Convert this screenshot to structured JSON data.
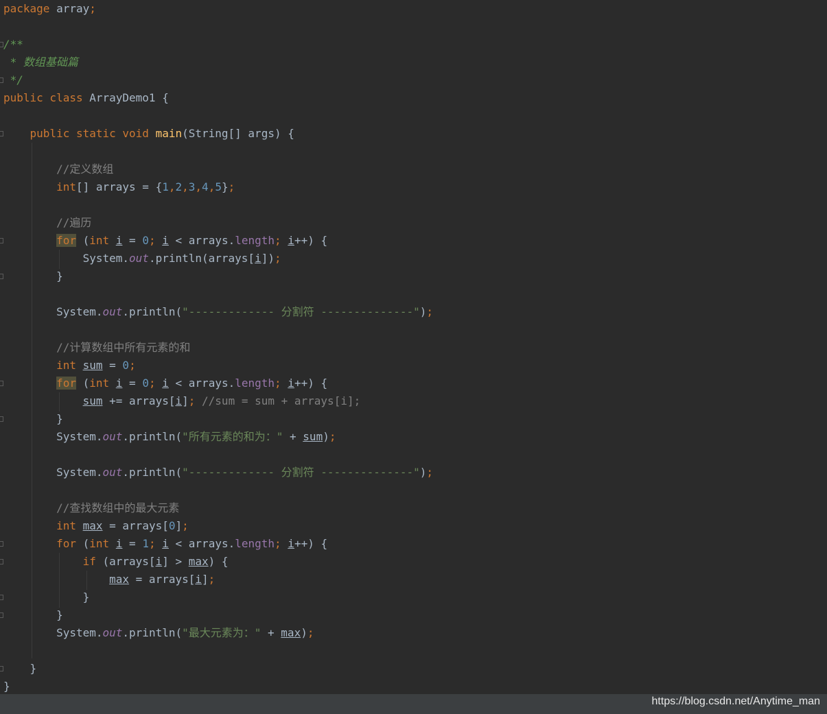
{
  "editor": {
    "colors": {
      "background": "#2b2b2b",
      "keyword": "#cc7832",
      "method": "#ffc66d",
      "number": "#6897bb",
      "string": "#6a8759",
      "comment": "#808080",
      "doc_comment": "#629755",
      "field": "#9876aa",
      "default_text": "#a9b7c6"
    },
    "lines": [
      {
        "tokens": [
          {
            "t": "package",
            "c": "kw"
          },
          {
            "t": " array"
          },
          {
            "t": ";",
            "c": "kw"
          }
        ]
      },
      {
        "tokens": []
      },
      {
        "tokens": [
          {
            "t": "/**",
            "c": "doc"
          }
        ]
      },
      {
        "tokens": [
          {
            "t": " * 数组基础篇",
            "c": "doc"
          }
        ]
      },
      {
        "tokens": [
          {
            "t": " */",
            "c": "doc"
          }
        ]
      },
      {
        "tokens": [
          {
            "t": "public class",
            "c": "kw"
          },
          {
            "t": " ArrayDemo1 {"
          }
        ]
      },
      {
        "tokens": []
      },
      {
        "tokens": [
          {
            "t": "    "
          },
          {
            "t": "public static void",
            "c": "kw"
          },
          {
            "t": " "
          },
          {
            "t": "main",
            "c": "fn"
          },
          {
            "t": "(String[] args) {"
          }
        ]
      },
      {
        "tokens": []
      },
      {
        "tokens": [
          {
            "t": "        "
          },
          {
            "t": "//定义数组",
            "c": "cmt"
          }
        ]
      },
      {
        "tokens": [
          {
            "t": "        "
          },
          {
            "t": "int",
            "c": "kw"
          },
          {
            "t": "[] arrays = {"
          },
          {
            "t": "1",
            "c": "num"
          },
          {
            "t": ",",
            "c": "kw"
          },
          {
            "t": "2",
            "c": "num"
          },
          {
            "t": ",",
            "c": "kw"
          },
          {
            "t": "3",
            "c": "num"
          },
          {
            "t": ",",
            "c": "kw"
          },
          {
            "t": "4",
            "c": "num"
          },
          {
            "t": ",",
            "c": "kw"
          },
          {
            "t": "5",
            "c": "num"
          },
          {
            "t": "}"
          },
          {
            "t": ";",
            "c": "kw"
          }
        ]
      },
      {
        "tokens": []
      },
      {
        "tokens": [
          {
            "t": "        "
          },
          {
            "t": "//遍历",
            "c": "cmt"
          }
        ]
      },
      {
        "tokens": [
          {
            "t": "        "
          },
          {
            "t": "for",
            "c": "kw hl"
          },
          {
            "t": " ("
          },
          {
            "t": "int",
            "c": "kw"
          },
          {
            "t": " "
          },
          {
            "t": "i",
            "c": "var"
          },
          {
            "t": " = "
          },
          {
            "t": "0",
            "c": "num"
          },
          {
            "t": ";",
            "c": "kw"
          },
          {
            "t": " "
          },
          {
            "t": "i",
            "c": "var"
          },
          {
            "t": " < arrays."
          },
          {
            "t": "length",
            "c": "fld"
          },
          {
            "t": ";",
            "c": "kw"
          },
          {
            "t": " "
          },
          {
            "t": "i",
            "c": "var"
          },
          {
            "t": "++) {"
          }
        ]
      },
      {
        "tokens": [
          {
            "t": "            System."
          },
          {
            "t": "out",
            "c": "static"
          },
          {
            "t": ".println(arrays["
          },
          {
            "t": "i",
            "c": "var"
          },
          {
            "t": "])"
          },
          {
            "t": ";",
            "c": "kw"
          }
        ]
      },
      {
        "tokens": [
          {
            "t": "        }"
          }
        ]
      },
      {
        "tokens": []
      },
      {
        "tokens": [
          {
            "t": "        System."
          },
          {
            "t": "out",
            "c": "static"
          },
          {
            "t": ".println("
          },
          {
            "t": "\"------------- 分割符 --------------\"",
            "c": "str"
          },
          {
            "t": ")"
          },
          {
            "t": ";",
            "c": "kw"
          }
        ]
      },
      {
        "tokens": []
      },
      {
        "tokens": [
          {
            "t": "        "
          },
          {
            "t": "//计算数组中所有元素的和",
            "c": "cmt"
          }
        ]
      },
      {
        "tokens": [
          {
            "t": "        "
          },
          {
            "t": "int",
            "c": "kw"
          },
          {
            "t": " "
          },
          {
            "t": "sum",
            "c": "var"
          },
          {
            "t": " = "
          },
          {
            "t": "0",
            "c": "num"
          },
          {
            "t": ";",
            "c": "kw"
          }
        ]
      },
      {
        "tokens": [
          {
            "t": "        "
          },
          {
            "t": "for",
            "c": "kw hl"
          },
          {
            "t": " ("
          },
          {
            "t": "int",
            "c": "kw"
          },
          {
            "t": " "
          },
          {
            "t": "i",
            "c": "var"
          },
          {
            "t": " = "
          },
          {
            "t": "0",
            "c": "num"
          },
          {
            "t": ";",
            "c": "kw"
          },
          {
            "t": " "
          },
          {
            "t": "i",
            "c": "var"
          },
          {
            "t": " < arrays."
          },
          {
            "t": "length",
            "c": "fld"
          },
          {
            "t": ";",
            "c": "kw"
          },
          {
            "t": " "
          },
          {
            "t": "i",
            "c": "var"
          },
          {
            "t": "++) {"
          }
        ]
      },
      {
        "tokens": [
          {
            "t": "            "
          },
          {
            "t": "sum",
            "c": "var"
          },
          {
            "t": " += arrays["
          },
          {
            "t": "i",
            "c": "var"
          },
          {
            "t": "]"
          },
          {
            "t": ";",
            "c": "kw"
          },
          {
            "t": " "
          },
          {
            "t": "//sum = sum + arrays[i];",
            "c": "cmt"
          }
        ]
      },
      {
        "tokens": [
          {
            "t": "        }"
          }
        ]
      },
      {
        "tokens": [
          {
            "t": "        System."
          },
          {
            "t": "out",
            "c": "static"
          },
          {
            "t": ".println("
          },
          {
            "t": "\"所有元素的和为：\"",
            "c": "str"
          },
          {
            "t": " + "
          },
          {
            "t": "sum",
            "c": "var"
          },
          {
            "t": ")"
          },
          {
            "t": ";",
            "c": "kw"
          }
        ]
      },
      {
        "tokens": []
      },
      {
        "tokens": [
          {
            "t": "        System."
          },
          {
            "t": "out",
            "c": "static"
          },
          {
            "t": ".println("
          },
          {
            "t": "\"------------- 分割符 --------------\"",
            "c": "str"
          },
          {
            "t": ")"
          },
          {
            "t": ";",
            "c": "kw"
          }
        ]
      },
      {
        "tokens": []
      },
      {
        "tokens": [
          {
            "t": "        "
          },
          {
            "t": "//查找数组中的最大元素",
            "c": "cmt"
          }
        ]
      },
      {
        "tokens": [
          {
            "t": "        "
          },
          {
            "t": "int",
            "c": "kw"
          },
          {
            "t": " "
          },
          {
            "t": "max",
            "c": "var"
          },
          {
            "t": " = arrays["
          },
          {
            "t": "0",
            "c": "num"
          },
          {
            "t": "]"
          },
          {
            "t": ";",
            "c": "kw"
          }
        ]
      },
      {
        "tokens": [
          {
            "t": "        "
          },
          {
            "t": "for",
            "c": "kw"
          },
          {
            "t": " ("
          },
          {
            "t": "int",
            "c": "kw"
          },
          {
            "t": " "
          },
          {
            "t": "i",
            "c": "var"
          },
          {
            "t": " = "
          },
          {
            "t": "1",
            "c": "num"
          },
          {
            "t": ";",
            "c": "kw"
          },
          {
            "t": " "
          },
          {
            "t": "i",
            "c": "var"
          },
          {
            "t": " < arrays."
          },
          {
            "t": "length",
            "c": "fld"
          },
          {
            "t": ";",
            "c": "kw"
          },
          {
            "t": " "
          },
          {
            "t": "i",
            "c": "var"
          },
          {
            "t": "++) {"
          }
        ]
      },
      {
        "tokens": [
          {
            "t": "            "
          },
          {
            "t": "if",
            "c": "kw"
          },
          {
            "t": " (arrays["
          },
          {
            "t": "i",
            "c": "var"
          },
          {
            "t": "] > "
          },
          {
            "t": "max",
            "c": "var"
          },
          {
            "t": ") {"
          }
        ]
      },
      {
        "tokens": [
          {
            "t": "                "
          },
          {
            "t": "max",
            "c": "var"
          },
          {
            "t": " = arrays["
          },
          {
            "t": "i",
            "c": "var"
          },
          {
            "t": "]"
          },
          {
            "t": ";",
            "c": "kw"
          }
        ]
      },
      {
        "tokens": [
          {
            "t": "            }"
          }
        ]
      },
      {
        "tokens": [
          {
            "t": "        }"
          }
        ]
      },
      {
        "tokens": [
          {
            "t": "        System."
          },
          {
            "t": "out",
            "c": "static"
          },
          {
            "t": ".println("
          },
          {
            "t": "\"最大元素为：\"",
            "c": "str"
          },
          {
            "t": " + "
          },
          {
            "t": "max",
            "c": "var"
          },
          {
            "t": ")"
          },
          {
            "t": ";",
            "c": "kw"
          }
        ]
      },
      {
        "tokens": []
      },
      {
        "tokens": [
          {
            "t": "    }"
          }
        ]
      },
      {
        "tokens": [
          {
            "t": "}"
          }
        ]
      }
    ]
  },
  "footer": {
    "watermark": "https://blog.csdn.net/Anytime_man"
  }
}
